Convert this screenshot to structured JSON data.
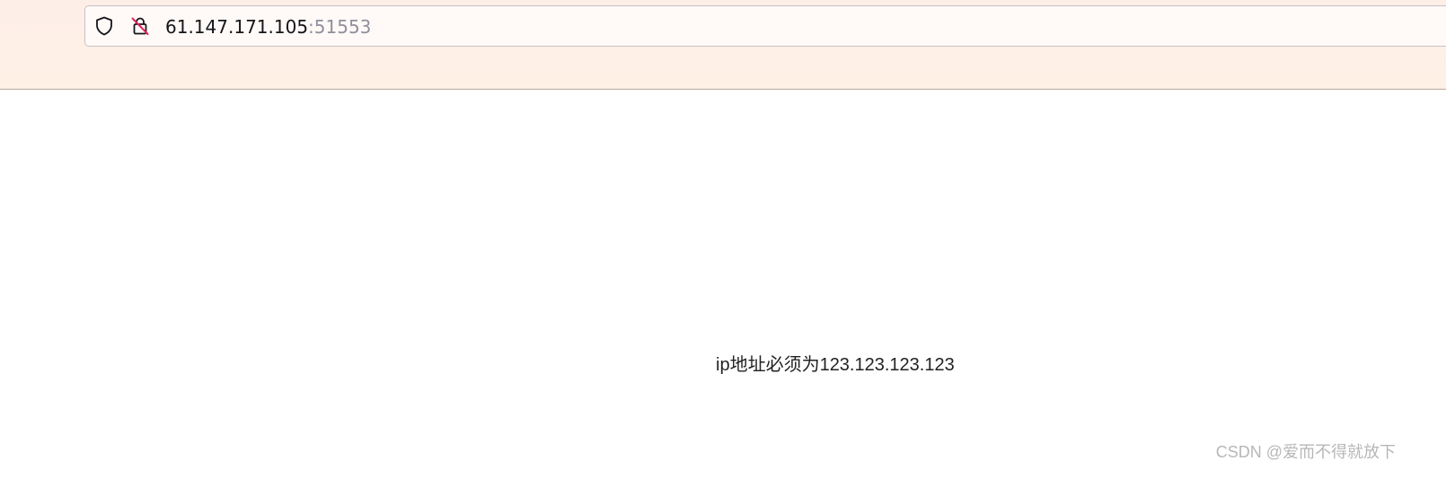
{
  "browser": {
    "url_host": "61.147.171.105",
    "url_port": ":51553",
    "icons": {
      "tracking_protection": "shield-icon",
      "connection_security": "insecure-lock-icon"
    },
    "colors": {
      "toolbar_background": "#fff0e6",
      "url_text": "#15141a",
      "url_port": "#8f8f9d",
      "insecure_slash": "#e0245e"
    }
  },
  "page": {
    "message": "ip地址必须为123.123.123.123",
    "watermark": "CSDN @爱而不得就放下"
  }
}
